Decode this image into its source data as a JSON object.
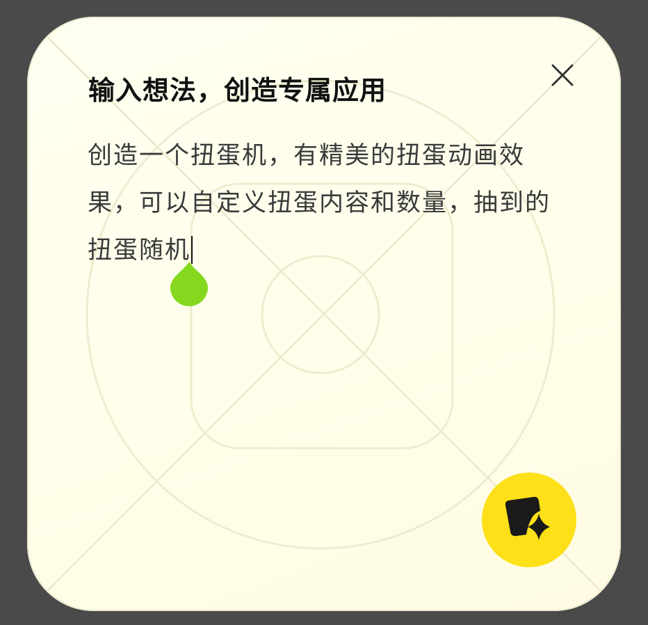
{
  "dialog": {
    "title": "输入想法，创造专属应用",
    "prompt_text": "创造一个扭蛋机，有精美的扭蛋动画效果，可以自定义扭蛋内容和数量，抽到的扭蛋随机",
    "close_icon": "close-icon",
    "generate_icon": "edit-sparkle-icon"
  },
  "colors": {
    "backdrop": "#4a4a4a",
    "dialog_bg": "#fffff0",
    "text_handle": "#86d81f",
    "fab": "#fde017"
  }
}
